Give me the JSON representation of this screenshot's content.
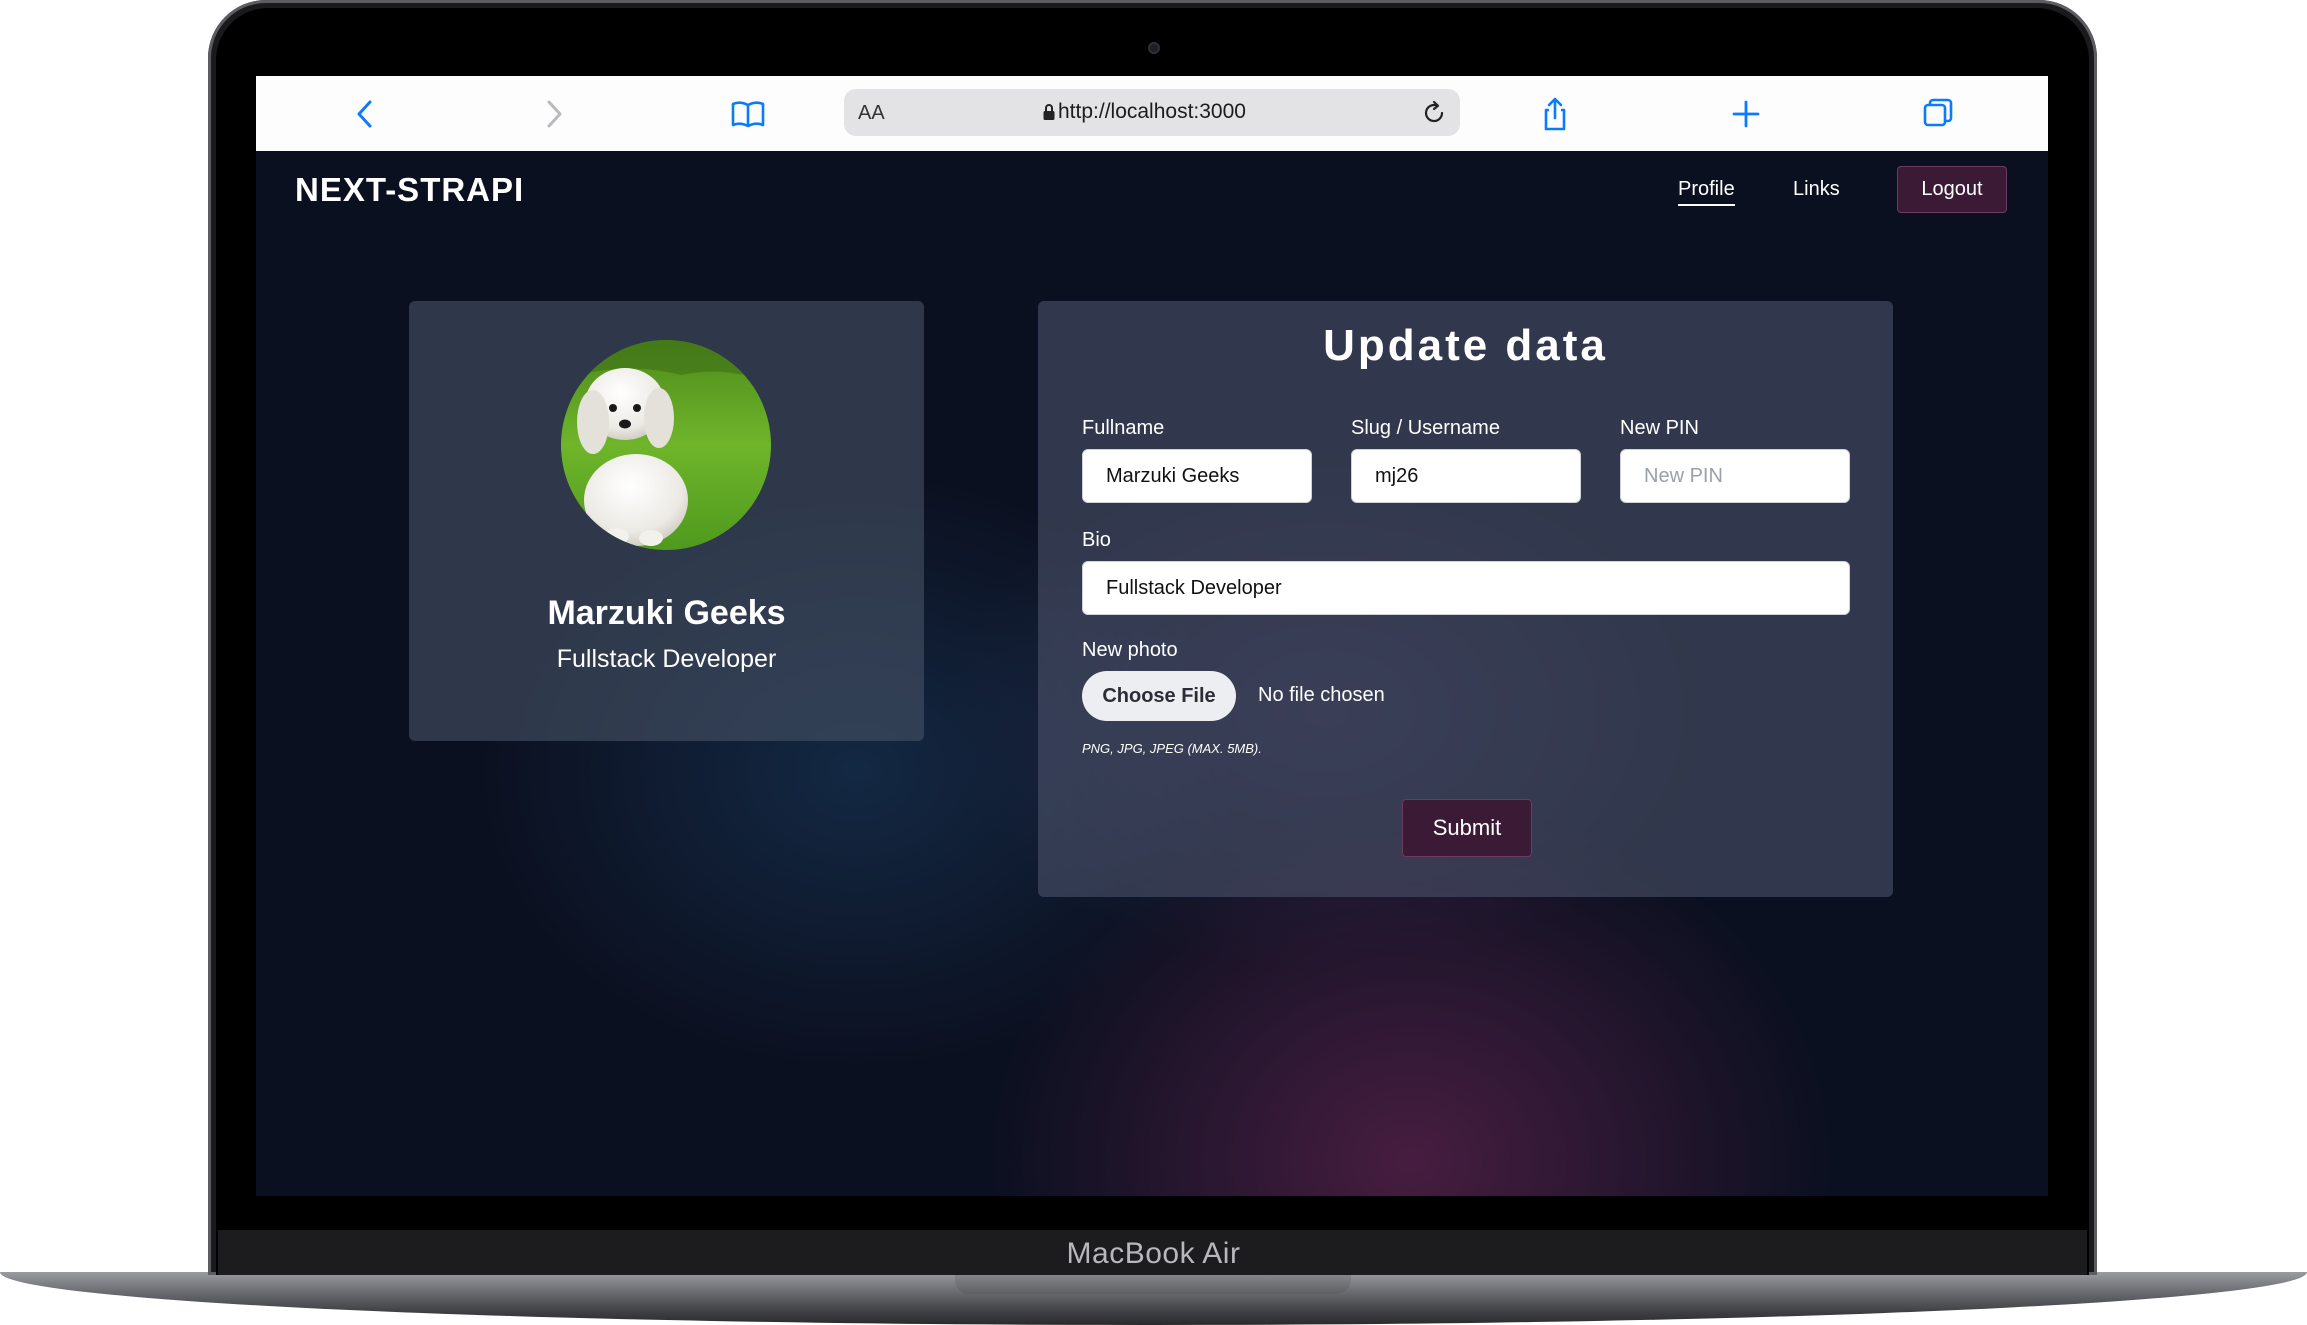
{
  "device": {
    "label": "MacBook Air"
  },
  "browser": {
    "text_size_label": "AA",
    "url": "http://localhost:3000"
  },
  "header": {
    "brand": "NEXT-STRAPI",
    "nav": {
      "profile": "Profile",
      "links": "Links"
    },
    "logout_label": "Logout"
  },
  "profile": {
    "name": "Marzuki Geeks",
    "bio": "Fullstack Developer"
  },
  "form": {
    "title": "Update data",
    "fullname": {
      "label": "Fullname",
      "value": "Marzuki Geeks"
    },
    "slug": {
      "label": "Slug / Username",
      "value": "mj26"
    },
    "pin": {
      "label": "New PIN",
      "value": "",
      "placeholder": "New PIN"
    },
    "bio": {
      "label": "Bio",
      "value": "Fullstack Developer"
    },
    "photo": {
      "label": "New photo",
      "button": "Choose File",
      "status": "No file chosen",
      "hint": "PNG, JPG, JPEG (MAX. 5MB)."
    },
    "submit_label": "Submit"
  },
  "colors": {
    "page_bg": "#0b1020",
    "button_bg": "#3b1a36",
    "browser_icon": "#0a7aff"
  },
  "icons": [
    "chevron-left-icon",
    "chevron-right-icon",
    "book-icon",
    "lock-icon",
    "reload-icon",
    "share-icon",
    "plus-icon",
    "tabs-icon"
  ]
}
